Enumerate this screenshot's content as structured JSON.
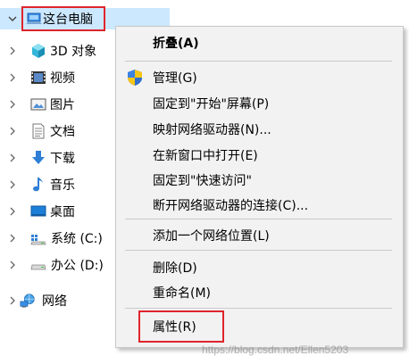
{
  "tree": {
    "root": {
      "label": "这台电脑",
      "expanded": true,
      "icon": "computer-icon"
    },
    "items": [
      {
        "label": "3D 对象",
        "icon": "3d-objects-icon"
      },
      {
        "label": "视频",
        "icon": "videos-icon"
      },
      {
        "label": "图片",
        "icon": "pictures-icon"
      },
      {
        "label": "文档",
        "icon": "documents-icon"
      },
      {
        "label": "下载",
        "icon": "downloads-icon"
      },
      {
        "label": "音乐",
        "icon": "music-icon"
      },
      {
        "label": "桌面",
        "icon": "desktop-icon"
      },
      {
        "label": "系统 (C:)",
        "icon": "system-drive-icon"
      },
      {
        "label": "办公 (D:)",
        "icon": "drive-icon"
      }
    ],
    "network": {
      "label": "网络",
      "icon": "network-icon"
    }
  },
  "context_menu": {
    "items": [
      {
        "label": "折叠(A)",
        "bold": true
      },
      {
        "label": "管理(G)",
        "icon": "uac-shield-icon"
      },
      {
        "label": "固定到\"开始\"屏幕(P)"
      },
      {
        "label": "映射网络驱动器(N)..."
      },
      {
        "label": "在新窗口中打开(E)"
      },
      {
        "label": "固定到\"快速访问\""
      },
      {
        "label": "断开网络驱动器的连接(C)..."
      },
      {
        "label": "添加一个网络位置(L)"
      },
      {
        "label": "删除(D)"
      },
      {
        "label": "重命名(M)"
      },
      {
        "label": "属性(R)"
      }
    ]
  },
  "watermark": "https://blog.csdn.net/Ellen5203",
  "colors": {
    "selection": "#cce8ff",
    "highlight_box": "#e0242b",
    "menu_background": "#f2f2f2"
  }
}
